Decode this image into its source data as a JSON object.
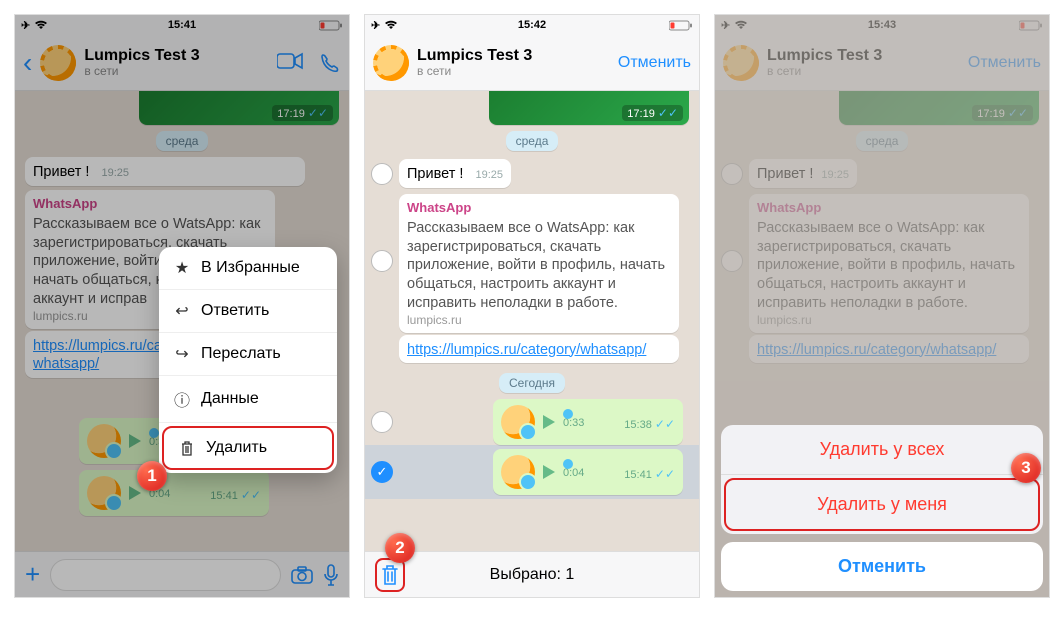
{
  "statusbar": {
    "t1": "15:41",
    "t2": "15:42",
    "t3": "15:43"
  },
  "nav": {
    "title": "Lumpics Test 3",
    "subtitle": "в сети",
    "cancel": "Отменить"
  },
  "day": {
    "wed": "среда",
    "today": "Сегодня"
  },
  "msg": {
    "hello": "Привет !",
    "hello_time": "19:25",
    "sender": "WhatsApp",
    "body": "Рассказываем все о WatsApp: как зарегистрироваться, скачать приложение, войти в профиль, начать общаться, настроить аккаунт и исправить неполадки в работе.",
    "body_short": "Рассказываем все о WatsApp: как зарегистрироваться, скачать приложение, войти в профиль, начать общаться, настроить аккаунт и исправ",
    "domain": "lumpics.ru",
    "link_full": "https://lumpics.ru/category/whatsapp/",
    "link_short": "https://lumpics.ru/cat\nwhatsapp/",
    "img_time": "17:19"
  },
  "voice": {
    "d1": "0:33",
    "t1": "15:38",
    "d2": "0:04",
    "t2": "15:41"
  },
  "menu": {
    "star": "В Избранные",
    "reply": "Ответить",
    "forward": "Переслать",
    "info": "Данные",
    "delete": "Удалить"
  },
  "selbar": {
    "count": "Выбрано:  1"
  },
  "sheet": {
    "del_all": "Удалить у всех",
    "del_me": "Удалить у меня",
    "cancel": "Отменить"
  },
  "badges": {
    "b1": "1",
    "b2": "2",
    "b3": "3"
  }
}
